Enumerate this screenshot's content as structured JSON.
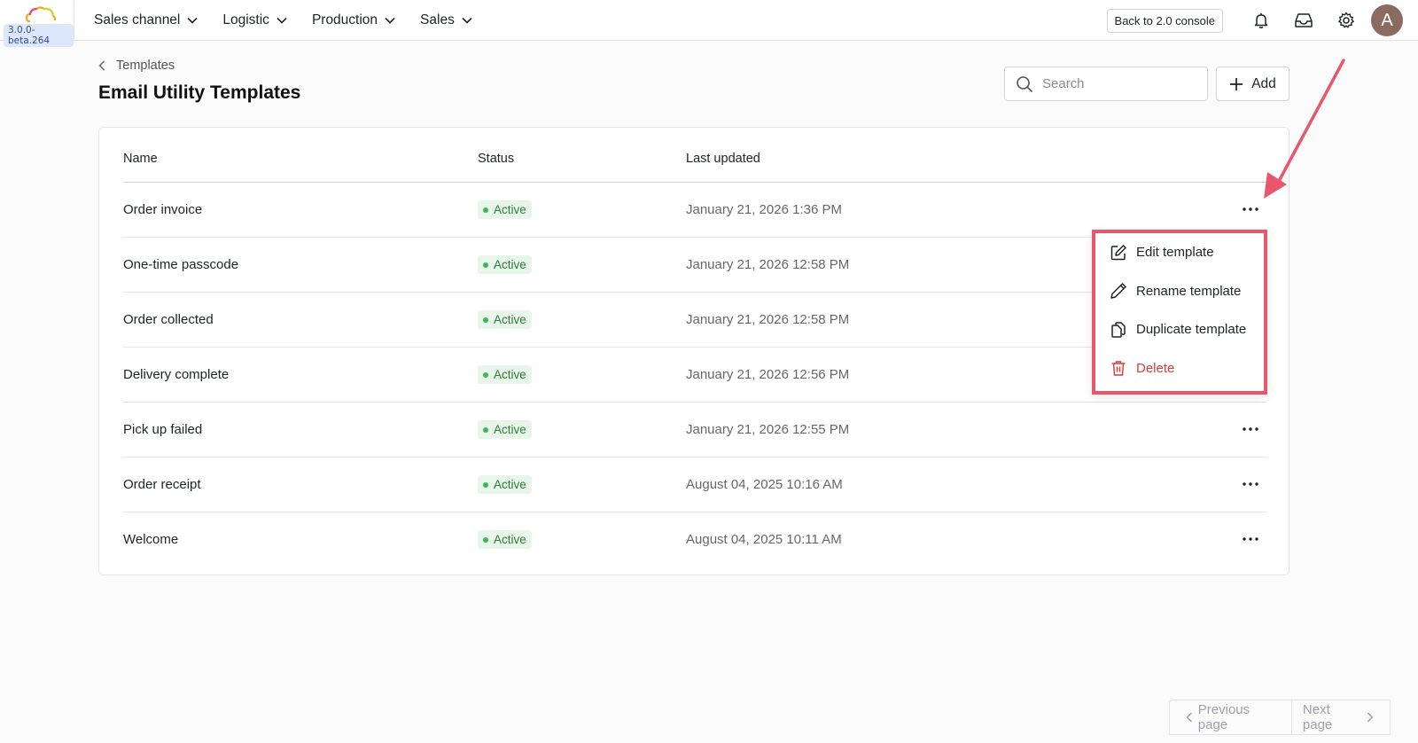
{
  "app": {
    "version": "3.0.0-beta.264",
    "back_console_label": "Back to 2.0 console",
    "avatar_initial": "A"
  },
  "nav": {
    "items": [
      {
        "label": "Sales channel"
      },
      {
        "label": "Logistic"
      },
      {
        "label": "Production"
      },
      {
        "label": "Sales"
      }
    ]
  },
  "header": {
    "breadcrumb": "Templates",
    "title": "Email Utility Templates",
    "search_placeholder": "Search",
    "add_label": "Add"
  },
  "table": {
    "columns": [
      "Name",
      "Status",
      "Last updated"
    ],
    "rows": [
      {
        "name": "Order invoice",
        "status": "Active",
        "updated": "January 21, 2026 1:36 PM"
      },
      {
        "name": "One-time passcode",
        "status": "Active",
        "updated": "January 21, 2026 12:58 PM"
      },
      {
        "name": "Order collected",
        "status": "Active",
        "updated": "January 21, 2026 12:58 PM"
      },
      {
        "name": "Delivery complete",
        "status": "Active",
        "updated": "January 21, 2026 12:56 PM"
      },
      {
        "name": "Pick up failed",
        "status": "Active",
        "updated": "January 21, 2026 12:55 PM"
      },
      {
        "name": "Order receipt",
        "status": "Active",
        "updated": "August 04, 2025 10:16 AM"
      },
      {
        "name": "Welcome",
        "status": "Active",
        "updated": "August 04, 2025 10:11 AM"
      }
    ]
  },
  "context_menu": {
    "items": [
      {
        "label": "Edit template",
        "icon": "edit-square-icon"
      },
      {
        "label": "Rename template",
        "icon": "pencil-icon"
      },
      {
        "label": "Duplicate template",
        "icon": "copy-icon"
      },
      {
        "label": "Delete",
        "icon": "trash-icon"
      }
    ]
  },
  "pagination": {
    "prev_label": "Previous page",
    "next_label": "Next page"
  },
  "colors": {
    "accent_highlight": "#e8586a",
    "status_active_bg": "#e8f6ea",
    "status_active_text": "#2f7a3b",
    "danger": "#d63d3d"
  }
}
